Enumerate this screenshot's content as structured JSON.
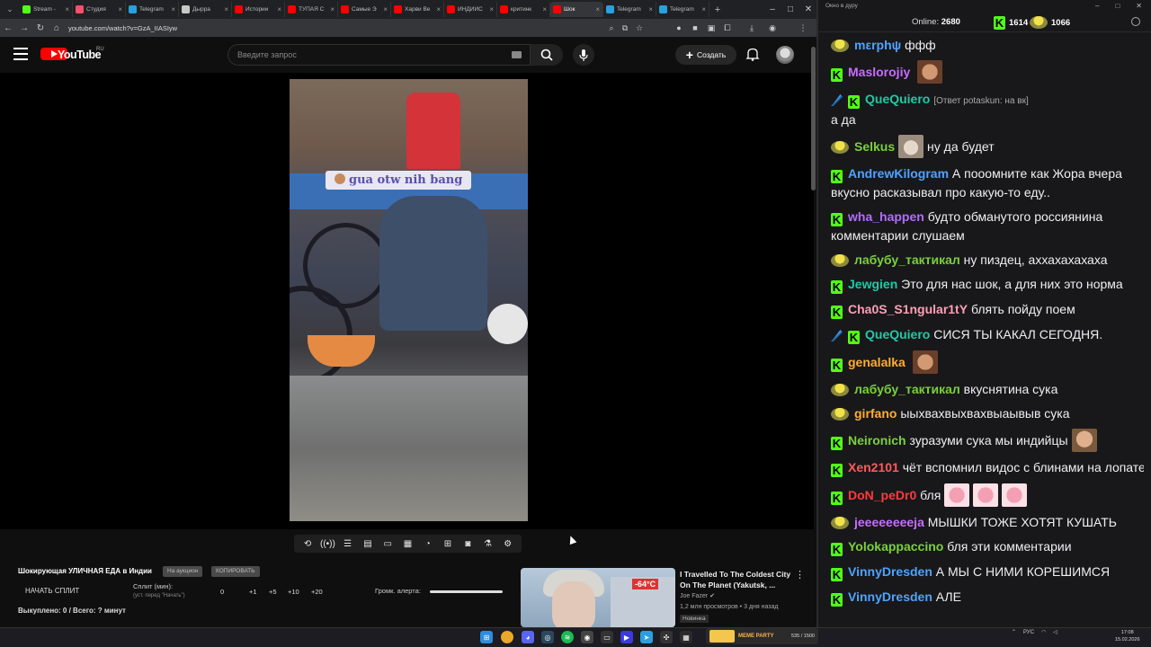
{
  "browser": {
    "tabs": [
      {
        "label": "Stream -",
        "color": "#53fc18"
      },
      {
        "label": "Студия",
        "color": "#ff4e6a"
      },
      {
        "label": "Telegram",
        "color": "#2aa0e0"
      },
      {
        "label": "Дырра",
        "color": "#c8c8c8"
      },
      {
        "label": "Истории",
        "color": "#ff0000"
      },
      {
        "label": "ТУПАЯ С",
        "color": "#ff0000"
      },
      {
        "label": "Самые Э",
        "color": "#ff0000"
      },
      {
        "label": "Харви Ве",
        "color": "#ff0000"
      },
      {
        "label": "ИНДИЙС",
        "color": "#ff0000"
      },
      {
        "label": "критинк",
        "color": "#ff0000"
      },
      {
        "label": "Шок",
        "color": "#ff0000",
        "active": true
      },
      {
        "label": "Telegram",
        "color": "#2aa0e0"
      },
      {
        "label": "Telegram",
        "color": "#2aa0e0"
      }
    ],
    "url": "youtube.com/watch?v=GzA_IIASIyw"
  },
  "youtube": {
    "logo_text": "YouTube",
    "region": "RU",
    "search_placeholder": "Введите запрос",
    "create_label": "Создать",
    "video_caption": "gua otw nih bang",
    "video_title": "Шокирующая УЛИЧНАЯ ЕДА в Индии",
    "pill_auction": "На аукцион",
    "pill_copy": "КОПИРОВАТЬ",
    "split_button": "НАЧАТЬ СПЛИТ",
    "split_label": "Сплит (мин):",
    "split_hint": "(уст. перед \"Начать\")",
    "split_values": [
      "0",
      "+1",
      "+5",
      "+10",
      "+20"
    ],
    "alert_label": "Громк. алерта:",
    "bought": "Выкуплено: 0 / Всего: ? минут",
    "recommendation": {
      "title": "I Travelled To The Coldest City On The Planet (Yakutsk, ...",
      "channel": "Joe Fazer",
      "views": "1,2 млн просмотров • 3 дня назад",
      "badge": "Новинка",
      "temp": "-64°C"
    }
  },
  "chat": {
    "window_title": "Окно в дуру",
    "online_label": "Online:",
    "online_count": "2680",
    "kick_count": "1614",
    "yellow_count": "1066",
    "messages": [
      {
        "badge": "y",
        "user": "mεrphψ",
        "color": "#4fa3ff",
        "text": "ффф"
      },
      {
        "badge": "k",
        "user": "Maslorojiy",
        "color": "#c86cff",
        "text": "",
        "emotes": [
          "face"
        ]
      },
      {
        "badge": "sk",
        "user": "QueQuiero",
        "color": "#22c9a5",
        "reply": "[Ответ potaskun: на вк]",
        "text": "а да"
      },
      {
        "badge": "y",
        "user": "Selkus",
        "color": "#7ad13a",
        "text": "ну да будет",
        "emotes_before": [
          "cat"
        ]
      },
      {
        "badge": "k",
        "user": "AndrewKilogram",
        "color": "#4fa3ff",
        "text": "А пооомните как Жора вчера вкусно расказывал про какую-то еду.."
      },
      {
        "badge": "k",
        "user": "wha_happen",
        "color": "#b36cff",
        "text": "будто обманутого россиянина комментарии слушаем"
      },
      {
        "badge": "y",
        "user": "лабубу_тактикал",
        "color": "#7ad13a",
        "text": "ну пиздец, аххахахахаха"
      },
      {
        "badge": "k",
        "user": "Jewgien",
        "color": "#22c9a5",
        "text": "Это для нас шок, а для них это норма"
      },
      {
        "badge": "k",
        "user": "Cha0S_S1ngular1tY",
        "color": "#ff9fb6",
        "text": "блять пойду поем"
      },
      {
        "badge": "sk",
        "user": "QueQuiero",
        "color": "#22c9a5",
        "text": "СИСЯ ТЫ КАКАЛ СЕГОДНЯ."
      },
      {
        "badge": "k",
        "user": "genalalka",
        "color": "#ffad33",
        "text": "",
        "emotes": [
          "face"
        ]
      },
      {
        "badge": "y",
        "user": "лабубу_тактикал",
        "color": "#7ad13a",
        "text": "вкуснятина сука"
      },
      {
        "badge": "y",
        "user": "girfano",
        "color": "#ffad33",
        "text": "ыыхвахвыхвахвыаывыв сука"
      },
      {
        "badge": "k",
        "user": "Neironich",
        "color": "#7ad13a",
        "text": "зуразуми сука мы индийцы",
        "emotes": [
          "guy"
        ]
      },
      {
        "badge": "k",
        "user": "Xen2101",
        "color": "#ff5a5a",
        "text": "чёт вспомнил видос с блинами на лопате"
      },
      {
        "badge": "k",
        "user": "DoN_peDr0",
        "color": "#ff3b3b",
        "text": "бля",
        "emotes": [
          "pig",
          "pig",
          "pig"
        ]
      },
      {
        "badge": "y",
        "user": "jeeeeeeeeja",
        "color": "#c86cff",
        "text": "МЫШКИ ТОЖЕ ХОТЯТ КУШАТЬ"
      },
      {
        "badge": "k",
        "user": "Yolokappaccino",
        "color": "#7ad13a",
        "text": "бля эти комментарии"
      },
      {
        "badge": "k",
        "user": "VinnyDresden",
        "color": "#4fa3ff",
        "text": "А МЫ С НИМИ КОРЕШИМСЯ"
      },
      {
        "badge": "k",
        "user": "VinnyDresden",
        "color": "#4fa3ff",
        "text": "АЛЕ"
      }
    ]
  },
  "taskbar": {
    "media_title": "МЕМЕ PARTY",
    "media_count": "535 / 1500",
    "lang": "РУС",
    "time": "17:08",
    "date": "15.02.2026"
  }
}
